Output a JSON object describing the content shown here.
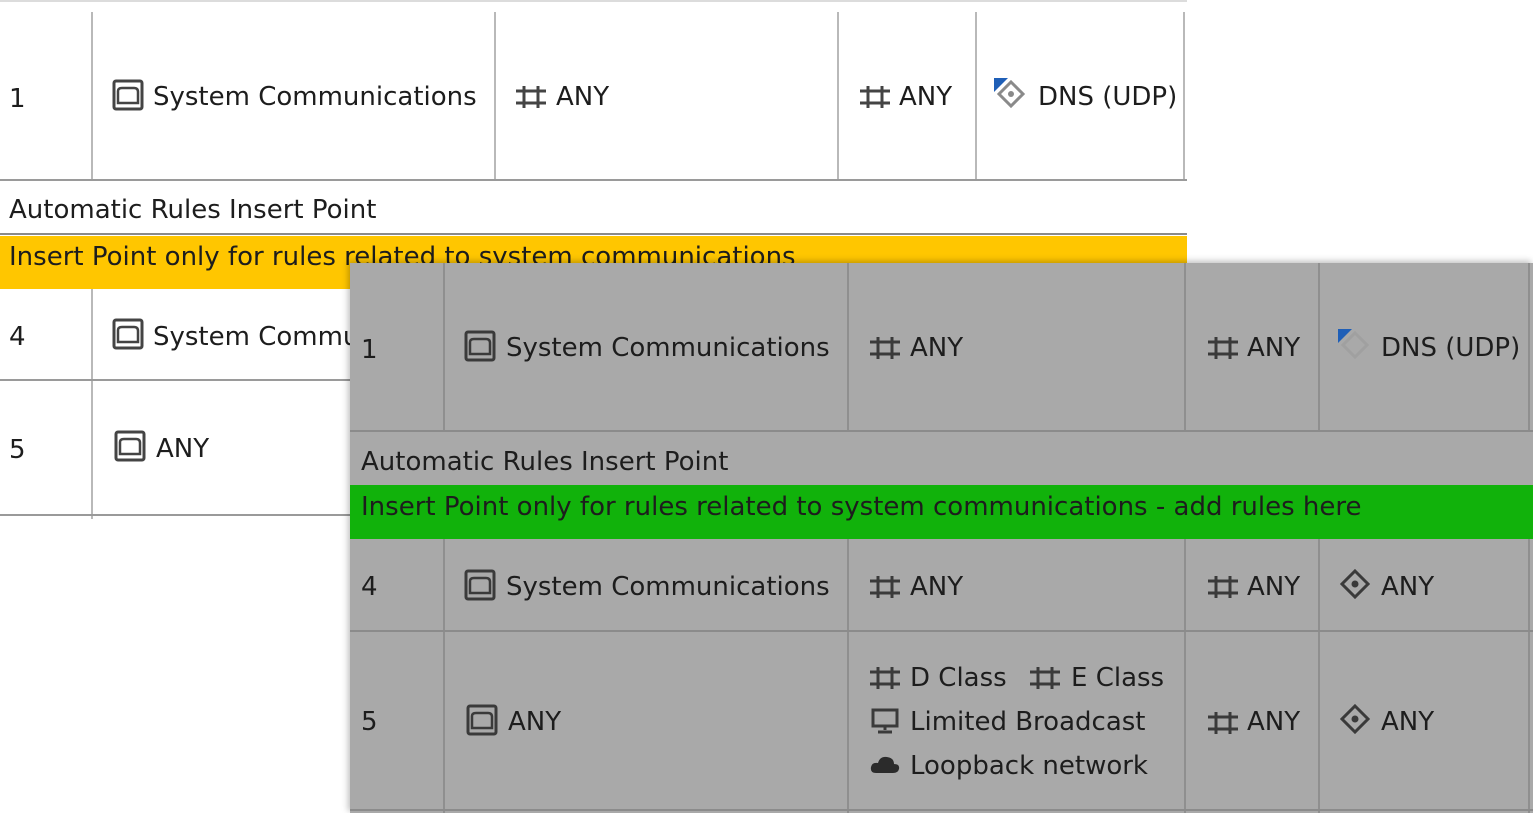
{
  "colors": {
    "insert_band_back": "#ffc600",
    "insert_band_front": "#11b20b",
    "front_bg": "#a9a9a9"
  },
  "icons": {
    "any_network": "network-icon",
    "zone": "zone-icon",
    "service": "service-icon",
    "host": "host-icon",
    "cloud": "cloud-icon"
  },
  "back": {
    "rule1": {
      "num": "1",
      "source": "System Communications",
      "destination": "ANY",
      "vpn": "ANY",
      "service": "DNS (UDP)"
    },
    "section_title": "Automatic Rules Insert Point",
    "section_band": "Insert Point only for rules related to system communications",
    "rule4": {
      "num": "4",
      "source": "System Commu"
    },
    "rule5": {
      "num": "5",
      "source": "ANY"
    }
  },
  "front": {
    "rule1": {
      "num": "1",
      "source": "System Communications",
      "destination": "ANY",
      "vpn": "ANY",
      "service": "DNS (UDP)"
    },
    "section_title": "Automatic Rules Insert Point",
    "section_band": "Insert Point only for rules related to system communications - add rules here",
    "rule4": {
      "num": "4",
      "source": "System Communications",
      "destination": "ANY",
      "vpn": "ANY",
      "service": "ANY"
    },
    "rule5": {
      "num": "5",
      "source": "ANY",
      "destinations": [
        "D Class",
        "E Class",
        "Limited Broadcast",
        "Loopback network"
      ],
      "vpn": "ANY",
      "service": "ANY"
    }
  }
}
